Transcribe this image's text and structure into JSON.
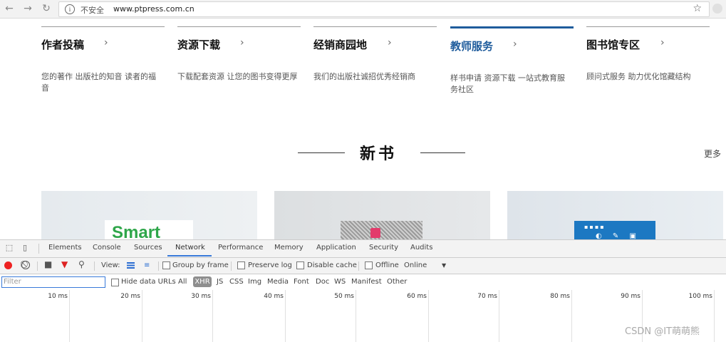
{
  "browser": {
    "security_label": "不安全",
    "url": "www.ptpress.com.cn"
  },
  "services": [
    {
      "title": "作者投稿",
      "desc": "您的著作 出版社的知音 读者的福音"
    },
    {
      "title": "资源下载",
      "desc": "下载配套资源 让您的图书变得更厚"
    },
    {
      "title": "经销商园地",
      "desc": "我们的出版社诚招优秀经销商"
    },
    {
      "title": "教师服务",
      "desc": "样书申请 资源下载 一站式教育服务社区"
    },
    {
      "title": "图书馆专区",
      "desc": "顾问式服务 助力优化馆藏结构"
    }
  ],
  "new_books": {
    "title": "新书",
    "more": "更多"
  },
  "books": {
    "cover1_text": "Smart"
  },
  "devtools": {
    "tabs": [
      "Elements",
      "Console",
      "Sources",
      "Network",
      "Performance",
      "Memory",
      "Application",
      "Security",
      "Audits"
    ],
    "toolbar": {
      "view_label": "View:",
      "group_by_frame": "Group by frame",
      "preserve_log": "Preserve log",
      "disable_cache": "Disable cache",
      "offline": "Offline",
      "throttle": "Online"
    },
    "filter": {
      "placeholder": "Filter",
      "hide_data_urls": "Hide data URLs",
      "types": [
        "All",
        "XHR",
        "JS",
        "CSS",
        "Img",
        "Media",
        "Font",
        "Doc",
        "WS",
        "Manifest",
        "Other"
      ]
    },
    "timeline_ticks": [
      "10 ms",
      "20 ms",
      "30 ms",
      "40 ms",
      "50 ms",
      "60 ms",
      "70 ms",
      "80 ms",
      "90 ms",
      "100 ms"
    ]
  },
  "watermark": "CSDN @IT萌萌熊",
  "colors": {
    "active_service": "#1f5c9c",
    "record_red": "#e22222",
    "devtools_accent": "#3879d9"
  }
}
